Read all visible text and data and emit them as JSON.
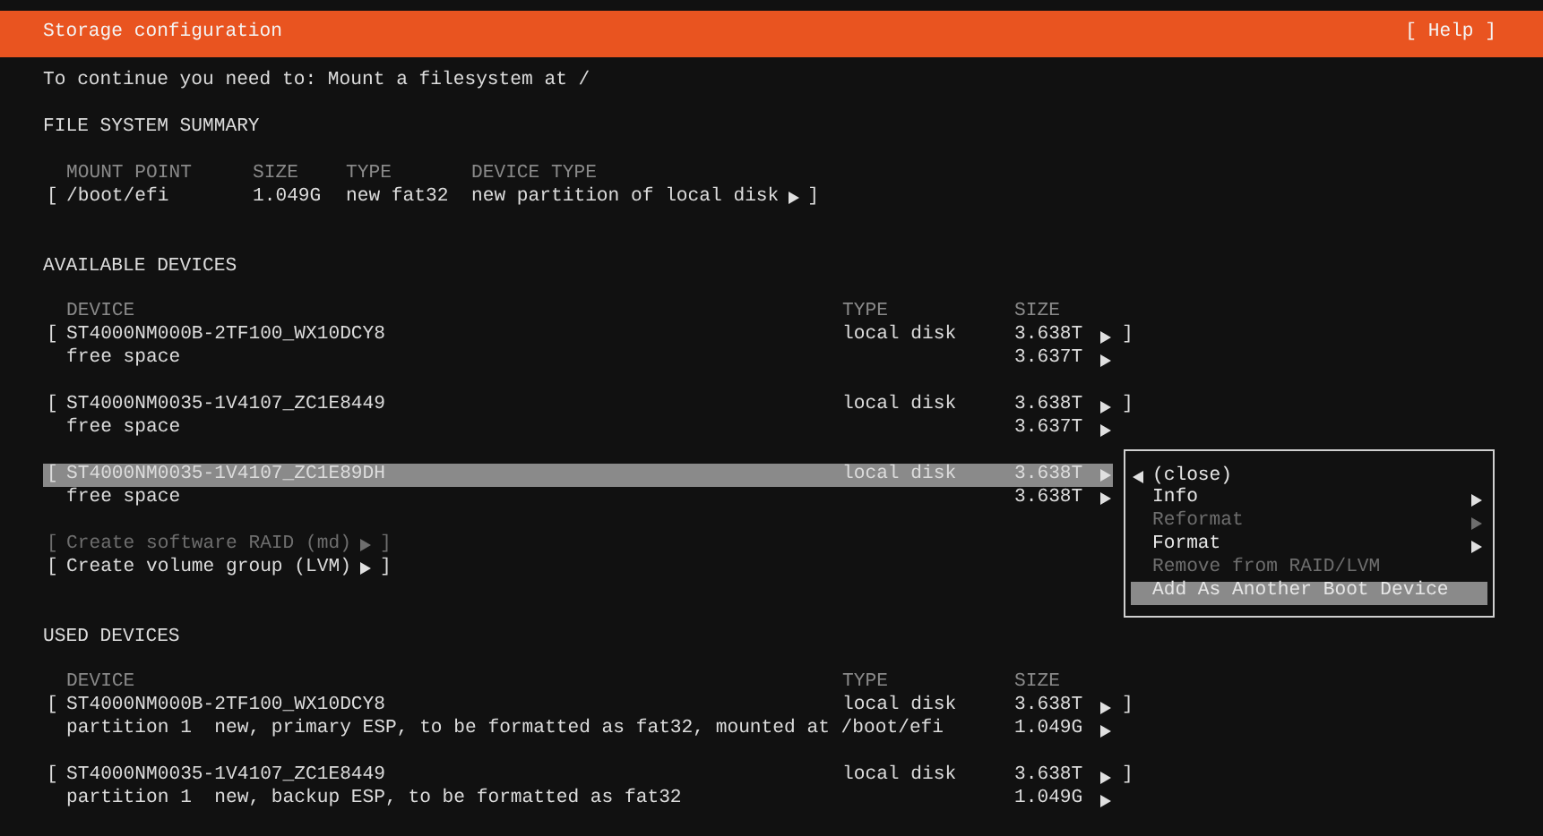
{
  "window": {
    "title": "Storage configuration",
    "help": "[ Help ]"
  },
  "message": "To continue you need to: Mount a filesystem at /",
  "fs_summary": {
    "heading": "FILE SYSTEM SUMMARY",
    "columns": [
      "MOUNT POINT",
      "SIZE",
      "TYPE",
      "DEVICE TYPE"
    ],
    "rows": [
      {
        "bracket_open": "[",
        "mount_point": "/boot/efi",
        "size": "1.049G",
        "type": "new fat32",
        "device_type": "new partition of local disk",
        "bracket_close": "]"
      }
    ]
  },
  "available_devices": {
    "heading": "AVAILABLE DEVICES",
    "columns": [
      "DEVICE",
      "TYPE",
      "SIZE"
    ],
    "devices": [
      {
        "bracket_open": "[",
        "name": "ST4000NM000B-2TF100_WX10DCY8",
        "type": "local disk",
        "size": "3.638T",
        "bracket_close": "]",
        "selected": false,
        "partitions": [
          {
            "name": "free space",
            "size": "3.637T"
          }
        ]
      },
      {
        "bracket_open": "[",
        "name": "ST4000NM0035-1V4107_ZC1E8449",
        "type": "local disk",
        "size": "3.638T",
        "bracket_close": "]",
        "selected": false,
        "partitions": [
          {
            "name": "free space",
            "size": "3.637T"
          }
        ]
      },
      {
        "bracket_open": "[",
        "name": "ST4000NM0035-1V4107_ZC1E89DH",
        "type": "local disk",
        "size": "3.638T",
        "selected": true,
        "partitions": [
          {
            "name": "free space",
            "size": "3.638T"
          }
        ]
      }
    ],
    "actions": [
      {
        "bracket_open": "[",
        "label": "Create software RAID (md)",
        "bracket_close": "]",
        "disabled": true
      },
      {
        "bracket_open": "[",
        "label": "Create volume group (LVM)",
        "bracket_close": "]",
        "disabled": false
      }
    ]
  },
  "used_devices": {
    "heading": "USED DEVICES",
    "columns": [
      "DEVICE",
      "TYPE",
      "SIZE"
    ],
    "devices": [
      {
        "bracket_open": "[",
        "name": "ST4000NM000B-2TF100_WX10DCY8",
        "type": "local disk",
        "size": "3.638T",
        "bracket_close": "]",
        "selected": false,
        "partitions": [
          {
            "name": "partition 1  new, primary ESP, to be formatted as fat32, mounted at /boot/efi",
            "size": "1.049G"
          }
        ]
      },
      {
        "bracket_open": "[",
        "name": "ST4000NM0035-1V4107_ZC1E8449",
        "type": "local disk",
        "size": "3.638T",
        "bracket_close": "]",
        "selected": false,
        "partitions": [
          {
            "name": "partition 1  new, backup ESP, to be formatted as fat32",
            "size": "1.049G"
          }
        ]
      }
    ]
  },
  "context_menu": {
    "items": [
      {
        "label": "(close)",
        "kind": "back",
        "disabled": false,
        "selected": false
      },
      {
        "label": "Info",
        "kind": "submenu",
        "disabled": false,
        "selected": false
      },
      {
        "label": "Reformat",
        "kind": "submenu",
        "disabled": true,
        "selected": false
      },
      {
        "label": "Format",
        "kind": "submenu",
        "disabled": false,
        "selected": false
      },
      {
        "label": "Remove from RAID/LVM",
        "kind": "action",
        "disabled": true,
        "selected": false
      },
      {
        "label": "Add As Another Boot Device",
        "kind": "action",
        "disabled": false,
        "selected": true
      }
    ]
  }
}
